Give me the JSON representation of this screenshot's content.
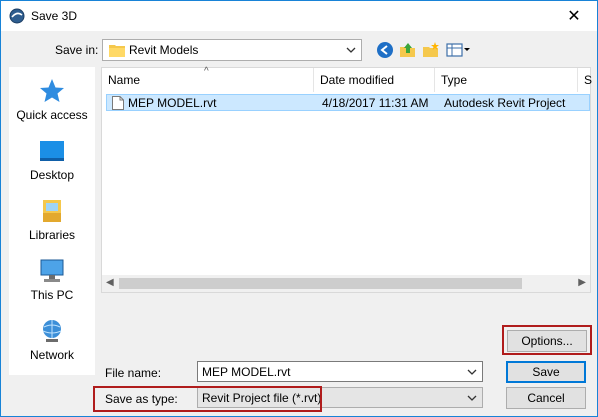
{
  "window": {
    "title": "Save 3D",
    "close_glyph": "✕"
  },
  "toolbar": {
    "save_in_label": "Save in:",
    "save_in_value": "Revit Models",
    "icons": [
      "back-icon",
      "up-folder-icon",
      "new-folder-icon",
      "view-menu-icon"
    ]
  },
  "places": [
    {
      "label": "Quick access",
      "icon": "star-icon"
    },
    {
      "label": "Desktop",
      "icon": "desktop-icon"
    },
    {
      "label": "Libraries",
      "icon": "libraries-icon"
    },
    {
      "label": "This PC",
      "icon": "computer-icon"
    },
    {
      "label": "Network",
      "icon": "network-icon"
    }
  ],
  "filelist": {
    "columns": [
      "Name",
      "Date modified",
      "Type",
      "S"
    ],
    "rows": [
      {
        "name": "MEP MODEL.rvt",
        "date": "4/18/2017 11:31 AM",
        "type": "Autodesk Revit Project",
        "selected": true
      }
    ]
  },
  "form": {
    "file_name_label": "File name:",
    "file_name_value": "MEP MODEL.rvt",
    "save_type_label": "Save as type:",
    "save_type_value": "Revit Project file (*.rvt)"
  },
  "buttons": {
    "options": "Options...",
    "save": "Save",
    "cancel": "Cancel"
  },
  "colors": {
    "selection": "#cce8ff",
    "highlight_box": "#b01c1c",
    "accent": "#0078d7"
  }
}
